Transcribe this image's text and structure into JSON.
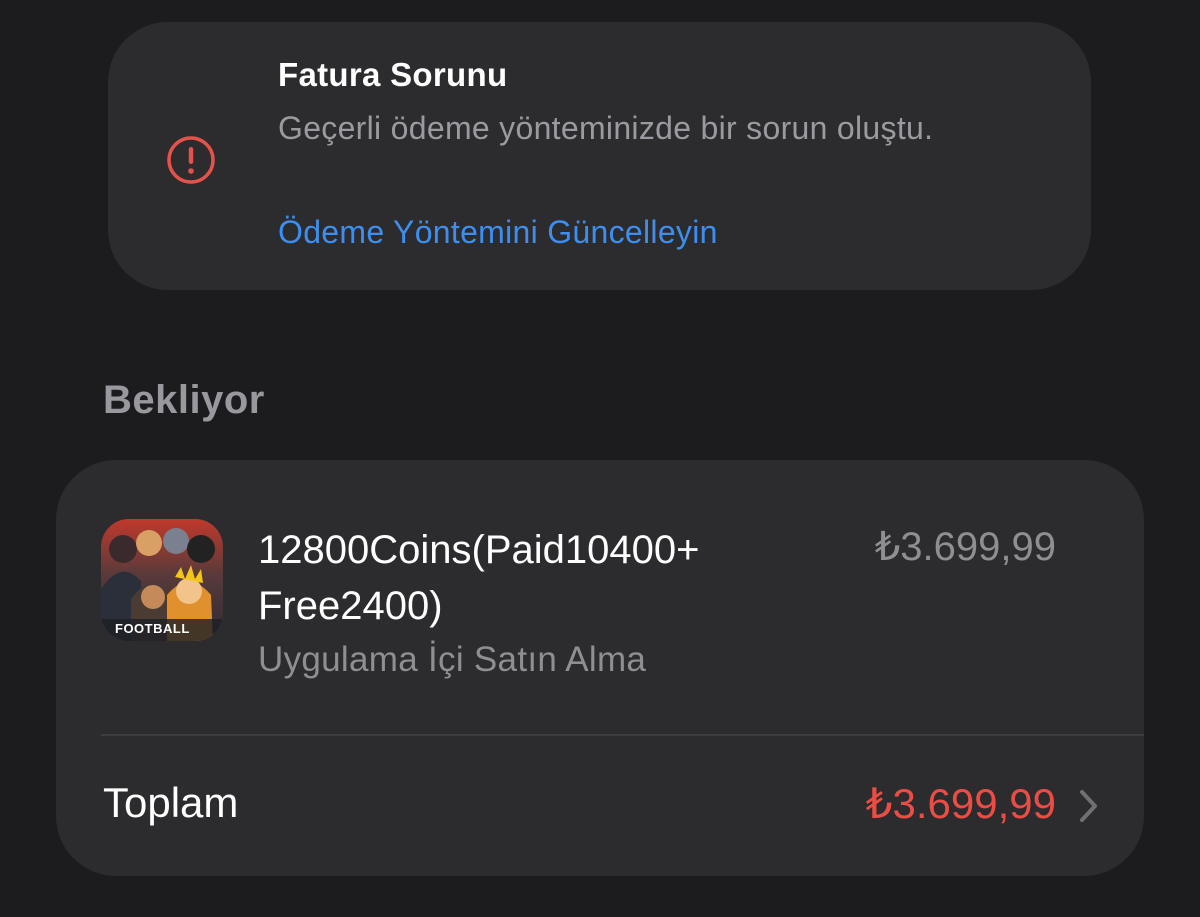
{
  "billing_alert": {
    "title": "Fatura Sorunu",
    "message": "Geçerli ödeme yönteminizde bir sorun oluştu.",
    "action_link": "Ödeme Yöntemini Güncelleyin",
    "icon": "exclamation-circle-icon",
    "icon_color": "#e5524b",
    "link_color": "#3c8ff0"
  },
  "pending": {
    "section_title": "Bekliyor",
    "item": {
      "app_icon": "efootball-app-icon",
      "app_icon_text": "FOOTBALL",
      "name": "12800Coins(Paid10400+ Free2400)",
      "type": "Uygulama İçi Satın Alma",
      "price": "₺3.699,99"
    },
    "total": {
      "label": "Toplam",
      "amount": "₺3.699,99",
      "amount_color": "#eb4d45",
      "chevron": "chevron-right-icon"
    }
  }
}
